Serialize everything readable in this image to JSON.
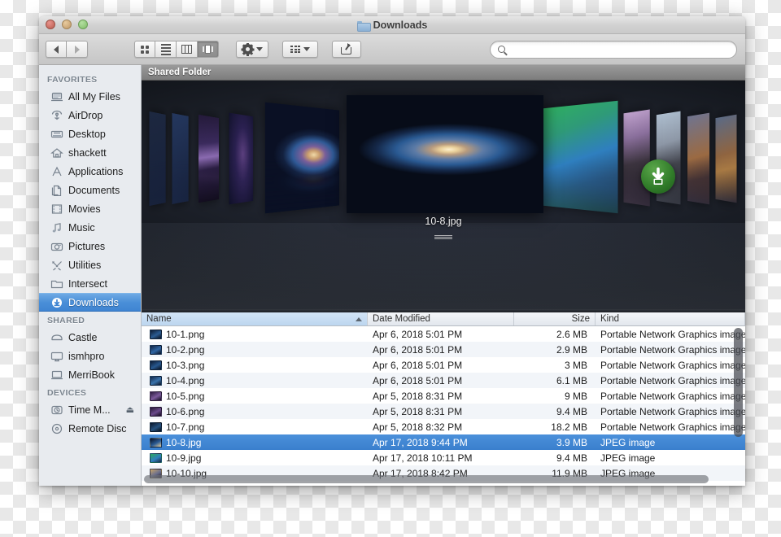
{
  "window": {
    "title": "Downloads",
    "title_icon": "folder-icon",
    "traffic_lights": [
      "close",
      "minimize",
      "maximize"
    ]
  },
  "toolbar": {
    "nav": {
      "back_label": "back-arrow-icon",
      "forward_label": "forward-arrow-icon"
    },
    "view_modes": [
      {
        "name": "icon-view",
        "icon": "grid-icon",
        "active": false
      },
      {
        "name": "list-view",
        "icon": "list-icon",
        "active": false
      },
      {
        "name": "column-view",
        "icon": "columns-icon",
        "active": false
      },
      {
        "name": "coverflow-view",
        "icon": "coverflow-icon",
        "active": true
      }
    ],
    "action_menu": {
      "name": "action-gear-menu",
      "icon": "gear-icon"
    },
    "arrange_menu": {
      "name": "arrange-menu",
      "icon": "arrange-icon"
    },
    "share_button": {
      "name": "share-button",
      "icon": "share-icon"
    }
  },
  "search": {
    "value": "",
    "placeholder": "",
    "icon": "search-icon"
  },
  "sidebar": {
    "sections": [
      {
        "header": "FAVORITES",
        "items": [
          {
            "label": "All My Files",
            "icon": "all-my-files-icon",
            "selected": false
          },
          {
            "label": "AirDrop",
            "icon": "airdrop-icon",
            "selected": false
          },
          {
            "label": "Desktop",
            "icon": "desktop-icon",
            "selected": false
          },
          {
            "label": "shackett",
            "icon": "home-icon",
            "selected": false
          },
          {
            "label": "Applications",
            "icon": "applications-icon",
            "selected": false
          },
          {
            "label": "Documents",
            "icon": "documents-icon",
            "selected": false
          },
          {
            "label": "Movies",
            "icon": "movies-icon",
            "selected": false
          },
          {
            "label": "Music",
            "icon": "music-icon",
            "selected": false
          },
          {
            "label": "Pictures",
            "icon": "pictures-icon",
            "selected": false
          },
          {
            "label": "Utilities",
            "icon": "utilities-icon",
            "selected": false
          },
          {
            "label": "Intersect",
            "icon": "folder-icon",
            "selected": false
          },
          {
            "label": "Downloads",
            "icon": "downloads-icon",
            "selected": true
          }
        ]
      },
      {
        "header": "SHARED",
        "items": [
          {
            "label": "Castle",
            "icon": "server-icon",
            "selected": false
          },
          {
            "label": "ismhpro",
            "icon": "display-icon",
            "selected": false
          },
          {
            "label": "MerriBook",
            "icon": "laptop-icon",
            "selected": false
          }
        ]
      },
      {
        "header": "DEVICES",
        "items": [
          {
            "label": "Time M...",
            "icon": "time-machine-icon",
            "selected": false,
            "eject": "⏏"
          },
          {
            "label": "Remote Disc",
            "icon": "disc-icon",
            "selected": false
          }
        ]
      }
    ]
  },
  "shared_folder_bar": {
    "label": "Shared Folder"
  },
  "coverflow": {
    "selected_filename": "10-8.jpg",
    "download_badge_icon": "download-badge-icon",
    "covers": [
      {
        "name": "cover-far-left-1",
        "colors": [
          "#1d2840",
          "#16203a"
        ]
      },
      {
        "name": "cover-far-left-2",
        "colors": [
          "#24375e",
          "#16203a"
        ]
      },
      {
        "name": "cover-aurora",
        "colors": [
          "#2b1f45",
          "#7a5b9e",
          "#140e22"
        ]
      },
      {
        "name": "cover-nebula",
        "colors": [
          "#151a33",
          "#3a2a52",
          "#0b0d1c"
        ]
      },
      {
        "name": "cover-galaxy-left",
        "colors": [
          "#101a35",
          "#2f5a96",
          "#c9a46a"
        ]
      },
      {
        "name": "cover-center-galaxy",
        "colors": [
          "#0a1020",
          "#2a5a93",
          "#e8cf9a"
        ]
      },
      {
        "name": "cover-mavericks-wave",
        "colors": [
          "#2aa85a",
          "#2f7fbf",
          "#1a2c3c"
        ]
      },
      {
        "name": "cover-yosemite",
        "colors": [
          "#b89ec6",
          "#3a3440",
          "#16141a"
        ]
      },
      {
        "name": "cover-elcapitan",
        "colors": [
          "#9fb4c8",
          "#4a4a52",
          "#1c1c22"
        ]
      },
      {
        "name": "cover-sierra",
        "colors": [
          "#6b6f8c",
          "#8a5f3c",
          "#2a2230"
        ]
      },
      {
        "name": "cover-highsierra",
        "colors": [
          "#5a6a86",
          "#a06a3a",
          "#221c24"
        ]
      }
    ]
  },
  "file_list": {
    "columns": [
      {
        "key": "name",
        "label": "Name",
        "sorted": true,
        "sort_dir": "asc"
      },
      {
        "key": "date",
        "label": "Date Modified",
        "sorted": false
      },
      {
        "key": "size",
        "label": "Size",
        "sorted": false
      },
      {
        "key": "kind",
        "label": "Kind",
        "sorted": false
      }
    ],
    "rows": [
      {
        "name": "10-1.png",
        "date": "Apr 6, 2018 5:01 PM",
        "size": "2.6 MB",
        "kind": "Portable Network Graphics image",
        "selected": false,
        "thumb": [
          "#0e1a30",
          "#2b5c92",
          "#0a0f1c"
        ]
      },
      {
        "name": "10-2.png",
        "date": "Apr 6, 2018 5:01 PM",
        "size": "2.9 MB",
        "kind": "Portable Network Graphics image",
        "selected": false,
        "thumb": [
          "#10203d",
          "#2f66a4",
          "#0b1122"
        ]
      },
      {
        "name": "10-3.png",
        "date": "Apr 6, 2018 5:01 PM",
        "size": "3 MB",
        "kind": "Portable Network Graphics image",
        "selected": false,
        "thumb": [
          "#0d1b33",
          "#27588f",
          "#090e1a"
        ]
      },
      {
        "name": "10-4.png",
        "date": "Apr 6, 2018 5:01 PM",
        "size": "6.1 MB",
        "kind": "Portable Network Graphics image",
        "selected": false,
        "thumb": [
          "#132544",
          "#3a74ad",
          "#0c1324"
        ]
      },
      {
        "name": "10-5.png",
        "date": "Apr 5, 2018 8:31 PM",
        "size": "9 MB",
        "kind": "Portable Network Graphics image",
        "selected": false,
        "thumb": [
          "#2a1b3c",
          "#7c5b9c",
          "#120c1e"
        ]
      },
      {
        "name": "10-6.png",
        "date": "Apr 5, 2018 8:31 PM",
        "size": "9.4 MB",
        "kind": "Portable Network Graphics image",
        "selected": false,
        "thumb": [
          "#231732",
          "#6a4a8c",
          "#100a1a"
        ]
      },
      {
        "name": "10-7.png",
        "date": "Apr 5, 2018 8:32 PM",
        "size": "18.2 MB",
        "kind": "Portable Network Graphics image",
        "selected": false,
        "thumb": [
          "#0b1528",
          "#26527f",
          "#070b14"
        ]
      },
      {
        "name": "10-8.jpg",
        "date": "Apr 17, 2018 9:44 PM",
        "size": "3.9 MB",
        "kind": "JPEG image",
        "selected": true,
        "thumb": [
          "#0a1020",
          "#2a5a93",
          "#e8cf9a"
        ]
      },
      {
        "name": "10-9.jpg",
        "date": "Apr 17, 2018 10:11 PM",
        "size": "9.4 MB",
        "kind": "JPEG image",
        "selected": false,
        "thumb": [
          "#2aa85a",
          "#2f7fbf",
          "#1a2c3c"
        ]
      },
      {
        "name": "10-10.jpg",
        "date": "Apr 17, 2018 8:42 PM",
        "size": "11.9 MB",
        "kind": "JPEG image",
        "selected": false,
        "thumb": [
          "#c9a56a",
          "#6b6f8c",
          "#2a2230"
        ]
      }
    ]
  },
  "scrollbars": {
    "vertical": "vertical-scrollbar",
    "horizontal": "horizontal-scrollbar"
  }
}
